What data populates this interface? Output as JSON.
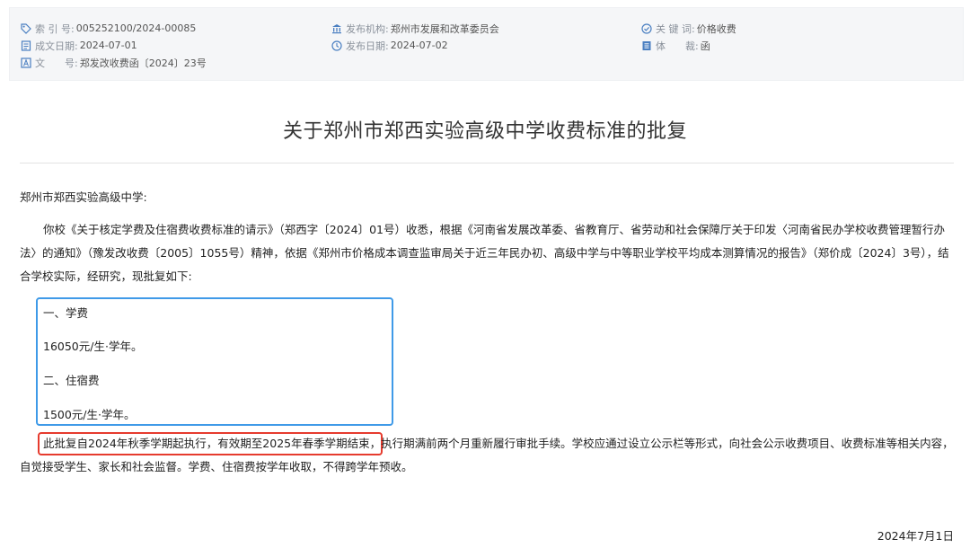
{
  "meta": {
    "index_label": "索 引 号:",
    "index_value": "005252100/2024-00085",
    "issuer_label": "发布机构:",
    "issuer_value": "郑州市发展和改革委员会",
    "keyword_label": "关 键 词:",
    "keyword_value": "价格收费",
    "written_label": "成文日期:",
    "written_value": "2024-07-01",
    "published_label": "发布日期:",
    "published_value": "2024-07-02",
    "genre_label": "体　　裁:",
    "genre_value": "函",
    "doc_no_label": "文　　号:",
    "doc_no_value": "郑发改收费函〔2024〕23号"
  },
  "document": {
    "title": "关于郑州市郑西实验高级中学收费标准的批复",
    "addressee": "郑州市郑西实验高级中学:",
    "para1": "你校《关于核定学费及住宿费收费标准的请示》（郑西字〔2024〕01号）收悉，根据《河南省发展改革委、省教育厅、省劳动和社会保障厅关于印发〈河南省民办学校收费管理暂行办法〉的通知》（豫发改收费〔2005〕1055号）精神，依据《郑州市价格成本调查监审局关于近三年民办初、高级中学与中等职业学校平均成本测算情况的报告》（郑价成〔2024〕3号），结合学校实际，经研究，现批复如下:",
    "section1_heading": "一、学费",
    "section1_value": "16050元/生·学年。",
    "section2_heading": "二、住宿费",
    "section2_value": "1500元/生·学年。",
    "para2_highlight": "此批复自2024年秋季学期起执行，有效期至2025年春季学期结束，",
    "para2_rest": "执行期满前两个月重新履行审批手续。学校应通过设立公示栏等形式，向社会公示收费项目、收费标准等相关内容，自觉接受学生、家长和社会监督。学费、住宿费按学年收取，不得跨学年预收。",
    "date": "2024年7月1日"
  },
  "colors": {
    "highlight_blue": "#3f9ae8",
    "highlight_red": "#e63b2e",
    "icon_blue": "#4a7fc1"
  }
}
